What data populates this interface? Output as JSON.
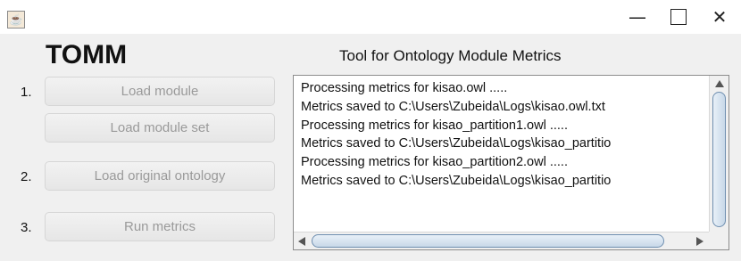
{
  "window": {
    "app_icon": "java-cup-icon",
    "minimize_symbol": "—",
    "close_symbol": "✕"
  },
  "app": {
    "title": "TOMM",
    "subtitle": "Tool for Ontology Module Metrics"
  },
  "steps": [
    {
      "number": "1.",
      "buttons": [
        "Load module",
        "Load module set"
      ]
    },
    {
      "number": "2.",
      "buttons": [
        "Load original ontology"
      ]
    },
    {
      "number": "3.",
      "buttons": [
        "Run metrics"
      ]
    }
  ],
  "log": {
    "lines": [
      "Processing metrics for kisao.owl .....",
      "Metrics saved to C:\\Users\\Zubeida\\Logs\\kisao.owl.txt",
      "Processing metrics for kisao_partition1.owl .....",
      "Metrics saved to C:\\Users\\Zubeida\\Logs\\kisao_partitio",
      "Processing metrics for kisao_partition2.owl .....",
      "Metrics saved to C:\\Users\\Zubeida\\Logs\\kisao_partitio"
    ]
  },
  "colors": {
    "panel_bg": "#f0f0f0",
    "disabled_text": "#9a9a9a",
    "scroll_thumb_border": "#6f8fb0"
  }
}
